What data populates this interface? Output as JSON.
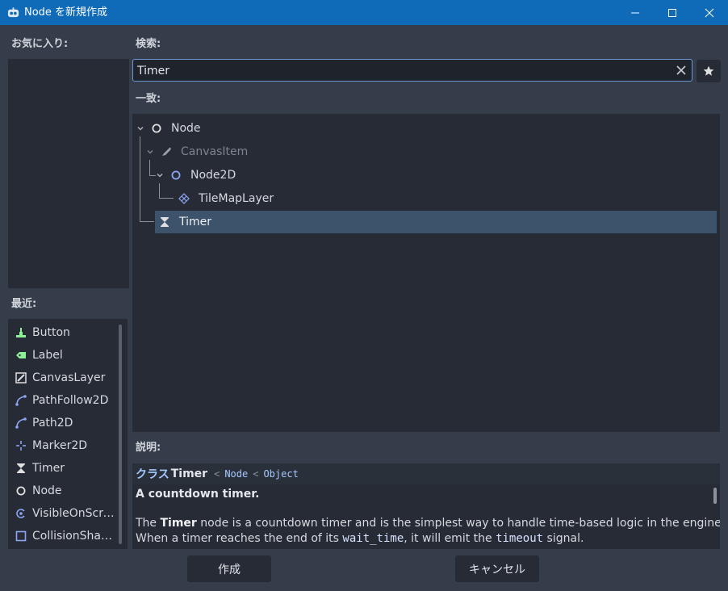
{
  "window": {
    "title": "Node を新規作成"
  },
  "favorites": {
    "label": "お気に入り:"
  },
  "recent": {
    "label": "最近:",
    "items": [
      {
        "label": "Button",
        "icon": "button-icon"
      },
      {
        "label": "Label",
        "icon": "label-icon"
      },
      {
        "label": "CanvasLayer",
        "icon": "canvaslayer-icon"
      },
      {
        "label": "PathFollow2D",
        "icon": "pathfollow2d-icon"
      },
      {
        "label": "Path2D",
        "icon": "path2d-icon"
      },
      {
        "label": "Marker2D",
        "icon": "marker2d-icon"
      },
      {
        "label": "Timer",
        "icon": "timer-icon"
      },
      {
        "label": "Node",
        "icon": "node-icon"
      },
      {
        "label": "VisibleOnScre...",
        "icon": "visibleonscreen-icon"
      },
      {
        "label": "CollisionShape...",
        "icon": "collisionshape-icon"
      }
    ]
  },
  "search": {
    "label": "検索:",
    "value": "Timer"
  },
  "matches": {
    "label": "一致:",
    "tree": [
      {
        "label": "Node",
        "icon": "node-icon",
        "dim": false
      },
      {
        "label": "CanvasItem",
        "icon": "canvasitem-icon",
        "dim": true
      },
      {
        "label": "Node2D",
        "icon": "node2d-icon",
        "dim": false
      },
      {
        "label": "TileMapLayer",
        "icon": "tilemaplayer-icon",
        "dim": false
      },
      {
        "label": "Timer",
        "icon": "timer-icon",
        "dim": false,
        "selected": true
      }
    ]
  },
  "description": {
    "label": "説明:",
    "class_prefix": "クラス",
    "class_name": "Timer",
    "inherits_sep": "<",
    "inherits_1": "Node",
    "inherits_2": "Object",
    "brief": "A countdown timer.",
    "body_1a": "The ",
    "body_1b": "Timer",
    "body_1c": " node is a countdown timer and is the simplest way to handle time-based logic in the engine.",
    "body_2a": "When a timer reaches the end of its ",
    "body_2b": "wait_time",
    "body_2c": ", it will emit the ",
    "body_2d": "timeout",
    "body_2e": " signal."
  },
  "buttons": {
    "create": "作成",
    "cancel": "キャンセル"
  },
  "colors": {
    "accent": "#0f6ab8",
    "selection": "#3d526b",
    "green_icon": "#8eef97",
    "blue_icon": "#8da5f3",
    "class_link": "#a5c8ff"
  }
}
